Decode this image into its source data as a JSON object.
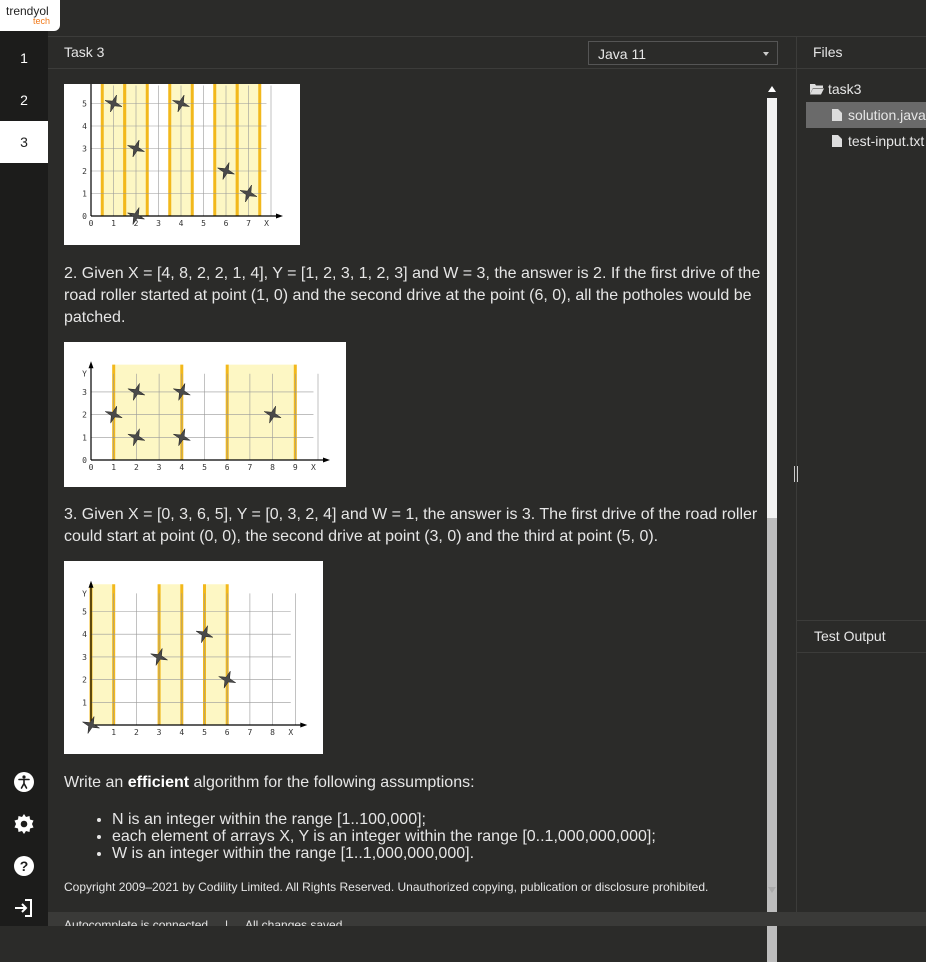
{
  "logo": {
    "brand": "trendyol",
    "sub": "tech"
  },
  "tasks": [
    "1",
    "2",
    "3"
  ],
  "active_task": "3",
  "header": {
    "task_title": "Task 3",
    "language": "Java 11"
  },
  "description": {
    "example2": "2. Given X = [4, 8, 2, 2, 1, 4], Y = [1, 2, 3, 1, 2, 3] and W = 3, the answer is 2. If the first drive of the road roller started at point (1, 0) and the second drive at the point (6, 0), all the potholes would be patched.",
    "example3": "3. Given X = [0, 3, 6, 5], Y = [0, 3, 2, 4] and W = 1, the answer is 3. The first drive of the road roller could start at point (0, 0), the second drive at point (3, 0) and the third at point (5, 0).",
    "assumptions_pre": "Write an ",
    "assumptions_bold": "efficient",
    "assumptions_post": " algorithm for the following assumptions:",
    "bullets": [
      "N is an integer within the range [1..100,000];",
      "each element of arrays X, Y is an integer within the range [0..1,000,000,000];",
      "W is an integer within the range [1..1,000,000,000]."
    ],
    "copyright": "Copyright 2009–2021 by Codility Limited. All Rights Reserved. Unauthorized copying, publication or disclosure prohibited."
  },
  "files": {
    "header": "Files",
    "folder": "task3",
    "items": [
      "solution.java",
      "test-input.txt"
    ],
    "selected": "solution.java"
  },
  "output": {
    "header": "Test Output"
  },
  "status": {
    "left": "Autocomplete is connected",
    "sep": "|",
    "right": "All changes saved"
  },
  "figures": [
    {
      "x_ticks": [
        "0",
        "1",
        "2",
        "3",
        "4",
        "5",
        "6",
        "7",
        "X"
      ],
      "y_ticks": [
        "0",
        "1",
        "2",
        "3",
        "4",
        "5"
      ],
      "y_label": "",
      "bands": [
        [
          0.5,
          1.5
        ],
        [
          1.5,
          2.5
        ],
        [
          3.5,
          4.5
        ],
        [
          5.5,
          6.5
        ],
        [
          6.5,
          7.5
        ]
      ],
      "points": [
        [
          1,
          5
        ],
        [
          2,
          3
        ],
        [
          2,
          0
        ],
        [
          4,
          5
        ],
        [
          6,
          2
        ],
        [
          7,
          1
        ]
      ]
    },
    {
      "x_ticks": [
        "0",
        "1",
        "2",
        "3",
        "4",
        "5",
        "6",
        "7",
        "8",
        "9",
        "X"
      ],
      "y_ticks": [
        "0",
        "1",
        "2",
        "3"
      ],
      "y_label": "Y",
      "bands": [
        [
          1,
          4
        ],
        [
          6,
          9
        ]
      ],
      "points": [
        [
          1,
          2
        ],
        [
          2,
          3
        ],
        [
          2,
          1
        ],
        [
          4,
          3
        ],
        [
          4,
          1
        ],
        [
          8,
          2
        ]
      ]
    },
    {
      "x_ticks": [
        "1",
        "2",
        "3",
        "4",
        "5",
        "6",
        "7",
        "8",
        "X"
      ],
      "y_ticks": [
        "1",
        "2",
        "3",
        "4",
        "5"
      ],
      "y_label": "Y",
      "bands": [
        [
          0,
          1
        ],
        [
          3,
          4
        ],
        [
          5,
          6
        ]
      ],
      "points": [
        [
          0,
          0
        ],
        [
          3,
          3
        ],
        [
          5,
          4
        ],
        [
          6,
          2
        ]
      ]
    }
  ],
  "colors": {
    "band": "#fdf7c4",
    "band_line": "#f2b81c",
    "star": "#4a4a4a"
  }
}
